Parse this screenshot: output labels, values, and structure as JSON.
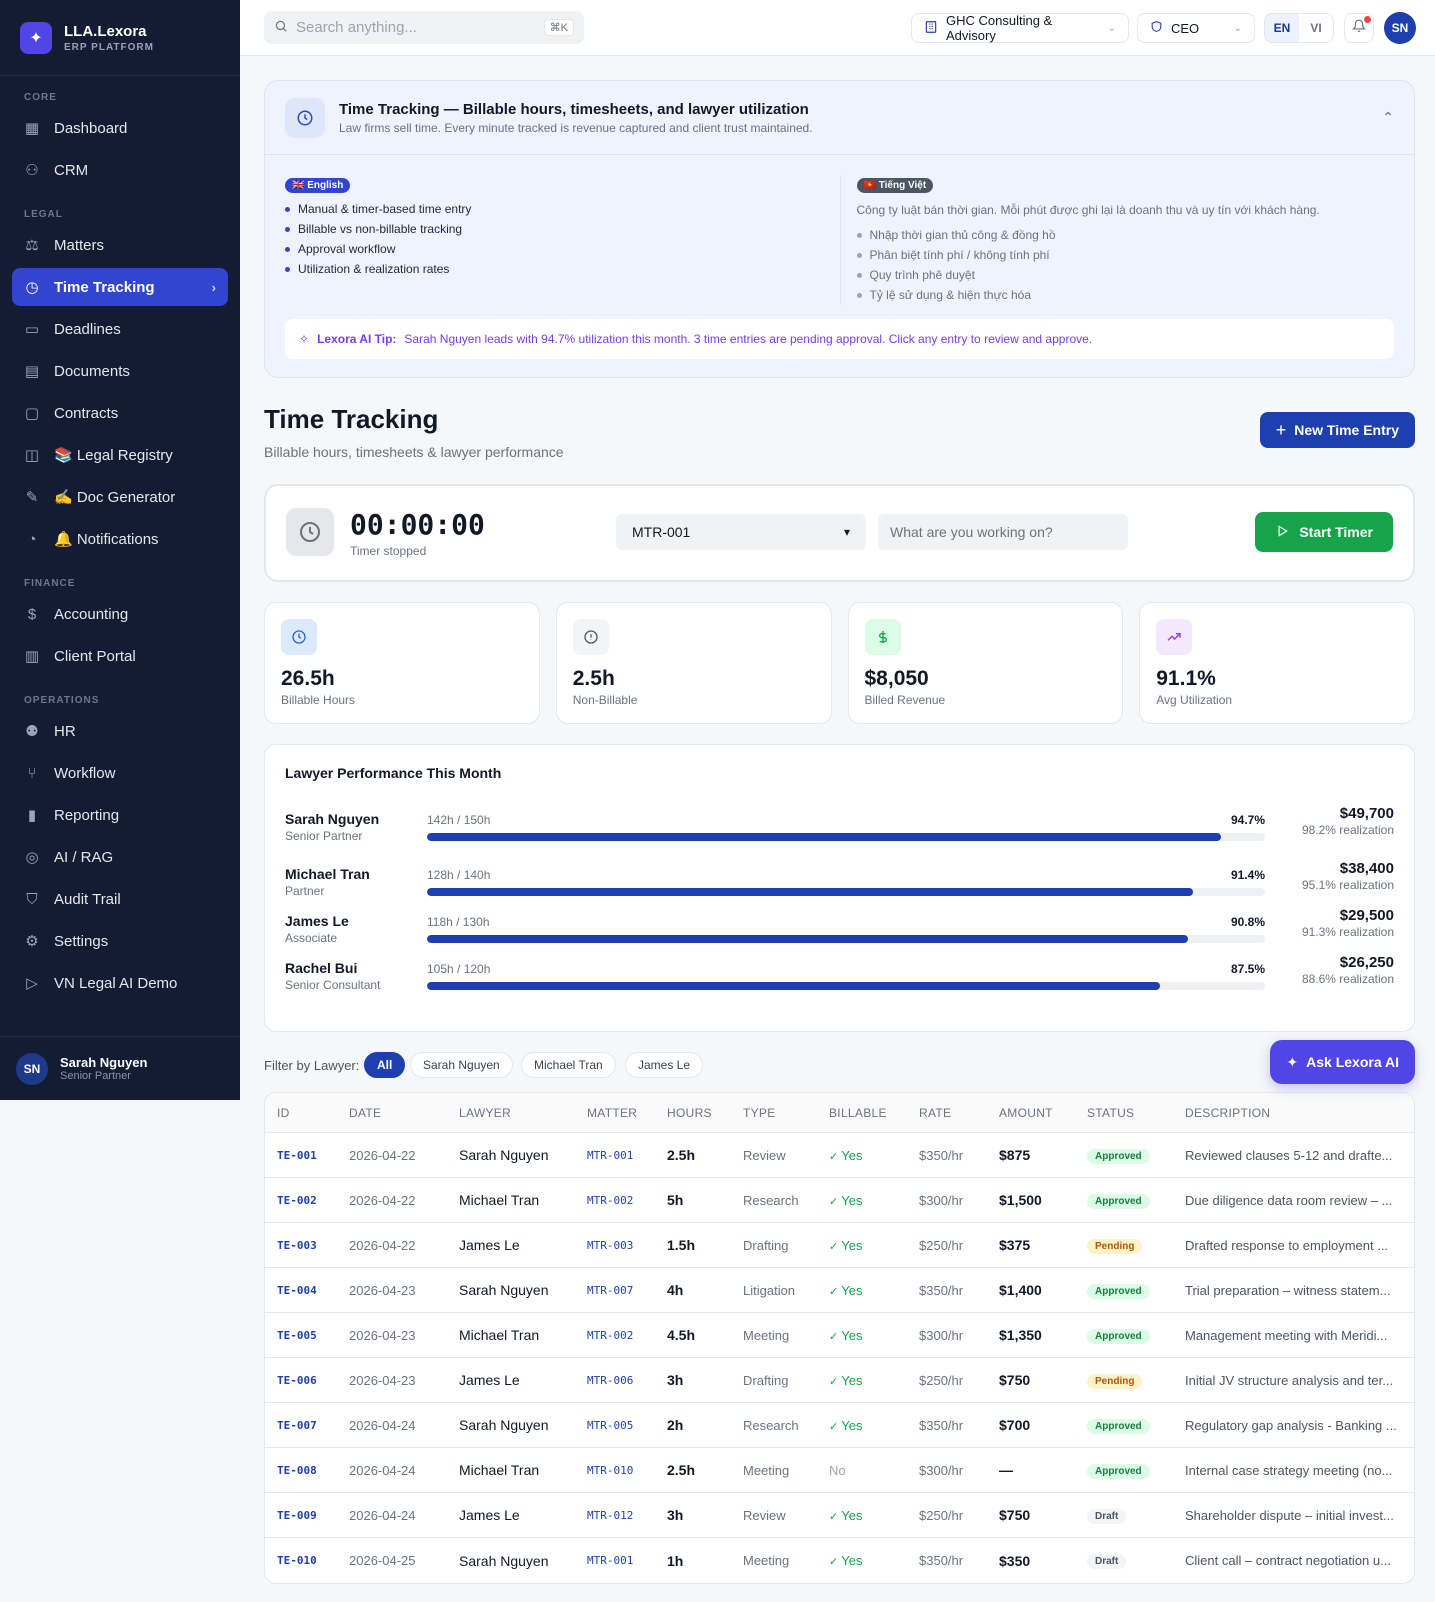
{
  "brand": {
    "name": "LLA.Lexora",
    "sub": "ERP PLATFORM"
  },
  "sidebar": {
    "sections": [
      {
        "label": "CORE",
        "items": [
          {
            "label": "Dashboard",
            "icon": "grid-icon"
          },
          {
            "label": "CRM",
            "icon": "users-icon"
          }
        ]
      },
      {
        "label": "LEGAL",
        "items": [
          {
            "label": "Matters",
            "icon": "scale-icon"
          },
          {
            "label": "Time Tracking",
            "icon": "clock-icon",
            "active": true
          },
          {
            "label": "Deadlines",
            "icon": "calendar-icon"
          },
          {
            "label": "Documents",
            "icon": "document-icon"
          },
          {
            "label": "Contracts",
            "icon": "contract-icon"
          },
          {
            "label": "📚 Legal Registry",
            "icon": "book-icon"
          },
          {
            "label": "✍️ Doc Generator",
            "icon": "wand-icon"
          },
          {
            "label": "🔔 Notifications",
            "icon": "bell-icon"
          }
        ]
      },
      {
        "label": "FINANCE",
        "items": [
          {
            "label": "Accounting",
            "icon": "dollar-icon"
          },
          {
            "label": "Client Portal",
            "icon": "building-icon"
          }
        ]
      },
      {
        "label": "OPERATIONS",
        "items": [
          {
            "label": "HR",
            "icon": "user-check-icon"
          },
          {
            "label": "Workflow",
            "icon": "branch-icon"
          },
          {
            "label": "Reporting",
            "icon": "bar-chart-icon"
          },
          {
            "label": "AI / RAG",
            "icon": "brain-icon"
          },
          {
            "label": "Audit Trail",
            "icon": "shield-icon"
          },
          {
            "label": "Settings",
            "icon": "gear-icon"
          },
          {
            "label": "VN Legal AI Demo",
            "icon": "play-icon"
          }
        ]
      }
    ],
    "user": {
      "initials": "SN",
      "name": "Sarah Nguyen",
      "role": "Senior Partner"
    }
  },
  "topbar": {
    "search_placeholder": "Search anything...",
    "shortcut": "⌘K",
    "company": "GHC Consulting & Advisory",
    "role": "CEO",
    "lang_en": "EN",
    "lang_vi": "VI",
    "avatar": "SN"
  },
  "info": {
    "title": "Time Tracking — Billable hours, timesheets, and lawyer utilization",
    "subtitle": "Law firms sell time. Every minute tracked is revenue captured and client trust maintained.",
    "en_badge": "🇬🇧 English",
    "en_items": [
      "Manual & timer-based time entry",
      "Billable vs non-billable tracking",
      "Approval workflow",
      "Utilization & realization rates"
    ],
    "vi_badge": "🇻🇳 Tiếng Việt",
    "vi_intro": "Công ty luật bán thời gian. Mỗi phút được ghi lại là doanh thu và uy tín với khách hàng.",
    "vi_items": [
      "Nhập thời gian thủ công & đồng hồ",
      "Phân biệt tính phí / không tính phí",
      "Quy trình phê duyệt",
      "Tỷ lệ sử dụng & hiện thực hóa"
    ],
    "tip_label": "Lexora AI Tip:",
    "tip_text": "Sarah Nguyen leads with 94.7% utilization this month. 3 time entries are pending approval. Click any entry to review and approve."
  },
  "page": {
    "title": "Time Tracking",
    "subtitle": "Billable hours, timesheets & lawyer performance",
    "new_entry": "New Time Entry"
  },
  "timer": {
    "time": "00:00:00",
    "status": "Timer stopped",
    "matter": "MTR-001",
    "placeholder": "What are you working on?",
    "start": "Start Timer"
  },
  "stats": [
    {
      "value": "26.5h",
      "label": "Billable Hours",
      "icon": "clock-icon",
      "color": "#2563eb",
      "bg": "#dbeafe"
    },
    {
      "value": "2.5h",
      "label": "Non-Billable",
      "icon": "alert-circle-icon",
      "color": "#4b5563",
      "bg": "#f3f4f6"
    },
    {
      "value": "$8,050",
      "label": "Billed Revenue",
      "icon": "dollar-icon",
      "color": "#16a34a",
      "bg": "#dcfce7"
    },
    {
      "value": "91.1%",
      "label": "Avg Utilization",
      "icon": "trending-up-icon",
      "color": "#9333ea",
      "bg": "#f3e8ff"
    }
  ],
  "performance": {
    "title": "Lawyer Performance This Month",
    "lawyers": [
      {
        "name": "Sarah Nguyen",
        "role": "Senior Partner",
        "hours": "142h / 150h",
        "pct": "94.7%",
        "fill": 0.947,
        "amount": "$49,700",
        "realization": "98.2% realization"
      },
      {
        "name": "Michael Tran",
        "role": "Partner",
        "hours": "128h / 140h",
        "pct": "91.4%",
        "fill": 0.914,
        "amount": "$38,400",
        "realization": "95.1% realization"
      },
      {
        "name": "James Le",
        "role": "Associate",
        "hours": "118h / 130h",
        "pct": "90.8%",
        "fill": 0.908,
        "amount": "$29,500",
        "realization": "91.3% realization"
      },
      {
        "name": "Rachel Bui",
        "role": "Senior Consultant",
        "hours": "105h / 120h",
        "pct": "87.5%",
        "fill": 0.875,
        "amount": "$26,250",
        "realization": "88.6% realization"
      }
    ]
  },
  "filter": {
    "label": "Filter by Lawyer:",
    "chips": [
      "All",
      "Sarah Nguyen",
      "Michael Tran",
      "James Le"
    ],
    "ask": "Ask Lexora AI"
  },
  "table": {
    "headers": [
      "ID",
      "DATE",
      "LAWYER",
      "MATTER",
      "HOURS",
      "TYPE",
      "BILLABLE",
      "RATE",
      "AMOUNT",
      "STATUS",
      "DESCRIPTION"
    ],
    "rows": [
      {
        "id": "TE-001",
        "date": "2026-04-22",
        "lawyer": "Sarah Nguyen",
        "matter": "MTR-001",
        "hours": "2.5h",
        "type": "Review",
        "billable": "Yes",
        "rate": "$350/hr",
        "amount": "$875",
        "status": "Approved",
        "desc": "Reviewed clauses 5-12 and drafte..."
      },
      {
        "id": "TE-002",
        "date": "2026-04-22",
        "lawyer": "Michael Tran",
        "matter": "MTR-002",
        "hours": "5h",
        "type": "Research",
        "billable": "Yes",
        "rate": "$300/hr",
        "amount": "$1,500",
        "status": "Approved",
        "desc": "Due diligence data room review – ..."
      },
      {
        "id": "TE-003",
        "date": "2026-04-22",
        "lawyer": "James Le",
        "matter": "MTR-003",
        "hours": "1.5h",
        "type": "Drafting",
        "billable": "Yes",
        "rate": "$250/hr",
        "amount": "$375",
        "status": "Pending",
        "desc": "Drafted response to employment ..."
      },
      {
        "id": "TE-004",
        "date": "2026-04-23",
        "lawyer": "Sarah Nguyen",
        "matter": "MTR-007",
        "hours": "4h",
        "type": "Litigation",
        "billable": "Yes",
        "rate": "$350/hr",
        "amount": "$1,400",
        "status": "Approved",
        "desc": "Trial preparation – witness statem..."
      },
      {
        "id": "TE-005",
        "date": "2026-04-23",
        "lawyer": "Michael Tran",
        "matter": "MTR-002",
        "hours": "4.5h",
        "type": "Meeting",
        "billable": "Yes",
        "rate": "$300/hr",
        "amount": "$1,350",
        "status": "Approved",
        "desc": "Management meeting with Meridi..."
      },
      {
        "id": "TE-006",
        "date": "2026-04-23",
        "lawyer": "James Le",
        "matter": "MTR-006",
        "hours": "3h",
        "type": "Drafting",
        "billable": "Yes",
        "rate": "$250/hr",
        "amount": "$750",
        "status": "Pending",
        "desc": "Initial JV structure analysis and ter..."
      },
      {
        "id": "TE-007",
        "date": "2026-04-24",
        "lawyer": "Sarah Nguyen",
        "matter": "MTR-005",
        "hours": "2h",
        "type": "Research",
        "billable": "Yes",
        "rate": "$350/hr",
        "amount": "$700",
        "status": "Approved",
        "desc": "Regulatory gap analysis - Banking ..."
      },
      {
        "id": "TE-008",
        "date": "2026-04-24",
        "lawyer": "Michael Tran",
        "matter": "MTR-010",
        "hours": "2.5h",
        "type": "Meeting",
        "billable": "No",
        "rate": "$300/hr",
        "amount": "—",
        "status": "Approved",
        "desc": "Internal case strategy meeting (no..."
      },
      {
        "id": "TE-009",
        "date": "2026-04-24",
        "lawyer": "James Le",
        "matter": "MTR-012",
        "hours": "3h",
        "type": "Review",
        "billable": "Yes",
        "rate": "$250/hr",
        "amount": "$750",
        "status": "Draft",
        "desc": "Shareholder dispute – initial invest..."
      },
      {
        "id": "TE-010",
        "date": "2026-04-25",
        "lawyer": "Sarah Nguyen",
        "matter": "MTR-001",
        "hours": "1h",
        "type": "Meeting",
        "billable": "Yes",
        "rate": "$350/hr",
        "amount": "$350",
        "status": "Draft",
        "desc": "Client call – contract negotiation u..."
      }
    ]
  }
}
